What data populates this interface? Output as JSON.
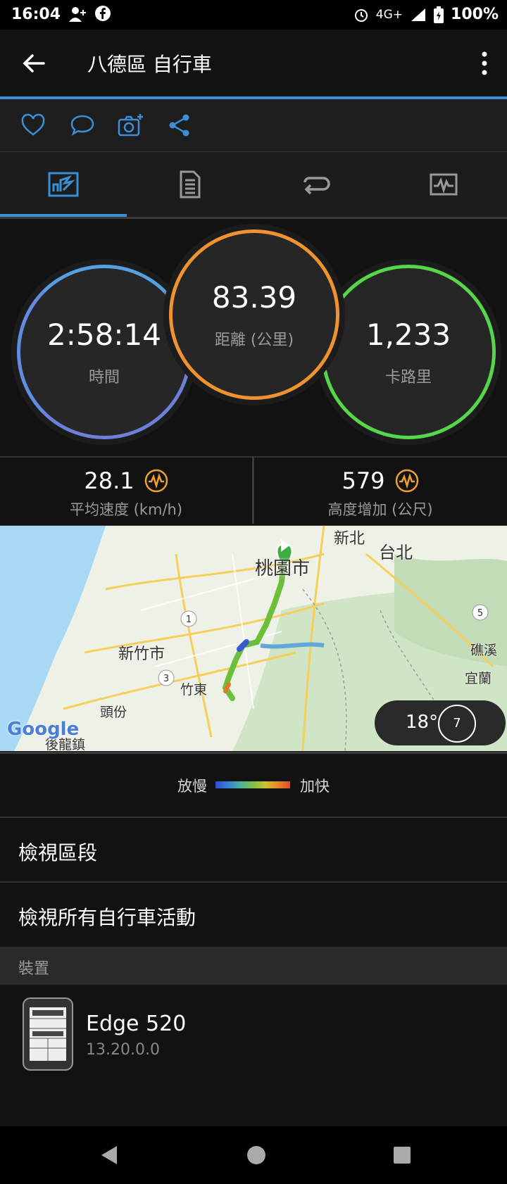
{
  "status": {
    "time": "16:04",
    "network": "4G+",
    "battery": "100%"
  },
  "appbar": {
    "title": "八德區 自行車"
  },
  "stats": {
    "time_value": "2:58:14",
    "time_label": "時間",
    "distance_value": "83.39",
    "distance_label": "距離 (公里)",
    "calories_value": "1,233",
    "calories_label": "卡路里"
  },
  "substats": {
    "speed_value": "28.1",
    "speed_label": "平均速度 (km/h)",
    "elev_value": "579",
    "elev_label": "高度增加 (公尺)"
  },
  "map": {
    "labels": [
      "新北",
      "台北",
      "桃園市",
      "新竹市",
      "竹東",
      "頭份",
      "後龍鎮",
      "礁溪",
      "宜蘭"
    ],
    "route_shields": [
      "1",
      "3",
      "5"
    ],
    "weather_temp": "18°",
    "wind_speed": "7",
    "google": "Google"
  },
  "legend": {
    "slow": "放慢",
    "fast": "加快"
  },
  "rows": {
    "segments": "檢視區段",
    "all_cycling": "檢視所有自行車活動"
  },
  "device_section": {
    "header": "裝置",
    "name": "Edge 520",
    "version": "13.20.0.0"
  },
  "colors": {
    "accent": "#3b8fd6",
    "time_ring": "#6f7fd9",
    "distance_ring": "#f0922f",
    "calories_ring": "#56d64a",
    "badge": "#f0a030"
  }
}
